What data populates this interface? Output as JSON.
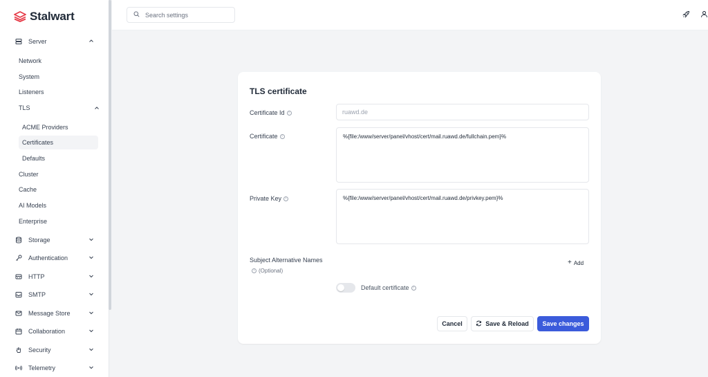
{
  "app": {
    "name": "Stalwart",
    "brand_color": "#e63946",
    "accent_color": "#3b5bdb"
  },
  "search": {
    "placeholder": "Search settings",
    "value": ""
  },
  "sidebar": {
    "server": {
      "label": "Server",
      "icon": "server-icon",
      "expanded": true
    },
    "server_items": [
      {
        "label": "Network"
      },
      {
        "label": "System"
      },
      {
        "label": "Listeners"
      }
    ],
    "tls": {
      "label": "TLS",
      "expanded": true
    },
    "tls_items": [
      {
        "label": "ACME Providers",
        "active": false
      },
      {
        "label": "Certificates",
        "active": true
      },
      {
        "label": "Defaults",
        "active": false
      }
    ],
    "server_items_after": [
      {
        "label": "Cluster"
      },
      {
        "label": "Cache"
      },
      {
        "label": "AI Models"
      },
      {
        "label": "Enterprise"
      }
    ],
    "groups": [
      {
        "label": "Storage",
        "icon": "database-icon"
      },
      {
        "label": "Authentication",
        "icon": "key-icon"
      },
      {
        "label": "HTTP",
        "icon": "globe-icon"
      },
      {
        "label": "SMTP",
        "icon": "inbox-icon"
      },
      {
        "label": "Message Store",
        "icon": "mail-icon"
      },
      {
        "label": "Collaboration",
        "icon": "calendar-icon"
      },
      {
        "label": "Security",
        "icon": "hand-icon"
      },
      {
        "label": "Telemetry",
        "icon": "broadcast-icon"
      }
    ]
  },
  "form": {
    "title": "TLS certificate",
    "certificate_id": {
      "label": "Certificate Id",
      "placeholder": "ruawd.de",
      "value": ""
    },
    "certificate": {
      "label": "Certificate",
      "value": "%{file:/www/server/panel/vhost/cert/mail.ruawd.de/fullchain.pem}%"
    },
    "private_key": {
      "label": "Private Key",
      "value": "%{file:/www/server/panel/vhost/cert/mail.ruawd.de/privkey.pem}%"
    },
    "san": {
      "label": "Subject Alternative Names",
      "optional": "(Optional)",
      "add_label": "Add"
    },
    "default_cert": {
      "label": "Default certificate",
      "enabled": false
    }
  },
  "actions": {
    "cancel": "Cancel",
    "save_reload": "Save & Reload",
    "save": "Save changes"
  }
}
